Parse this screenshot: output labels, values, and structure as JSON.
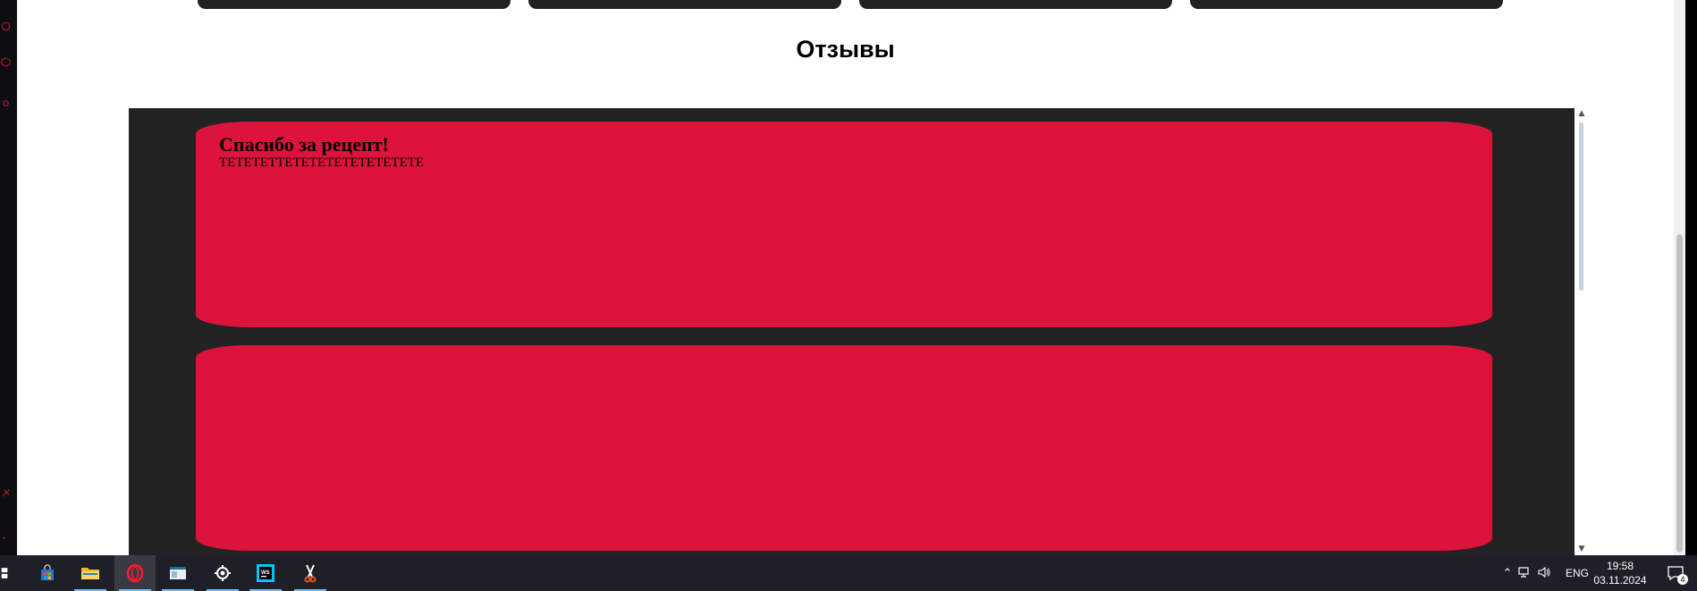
{
  "page": {
    "section_title": "Отзывы"
  },
  "reviews": [
    {
      "title": "Спасибо за рецепт!",
      "text": "ТЕТЕТЕТТЕТЕТЕТЕТЕТЕТЕТЕТЕ"
    },
    {
      "title": "",
      "text": ""
    }
  ],
  "taskbar": {
    "apps": [
      "windows-start",
      "microsoft-store",
      "file-explorer",
      "opera-browser",
      "window-app",
      "steam",
      "webstorm",
      "snipping-tool"
    ],
    "tray": {
      "language": "ENG",
      "time": "19:58",
      "date": "03.11.2024",
      "notification_count": "4"
    }
  },
  "colors": {
    "review_bg": "#dc143c",
    "reviews_container_bg": "#222222",
    "taskbar_bg": "#1f1f27",
    "accent": "#76b9ed"
  }
}
